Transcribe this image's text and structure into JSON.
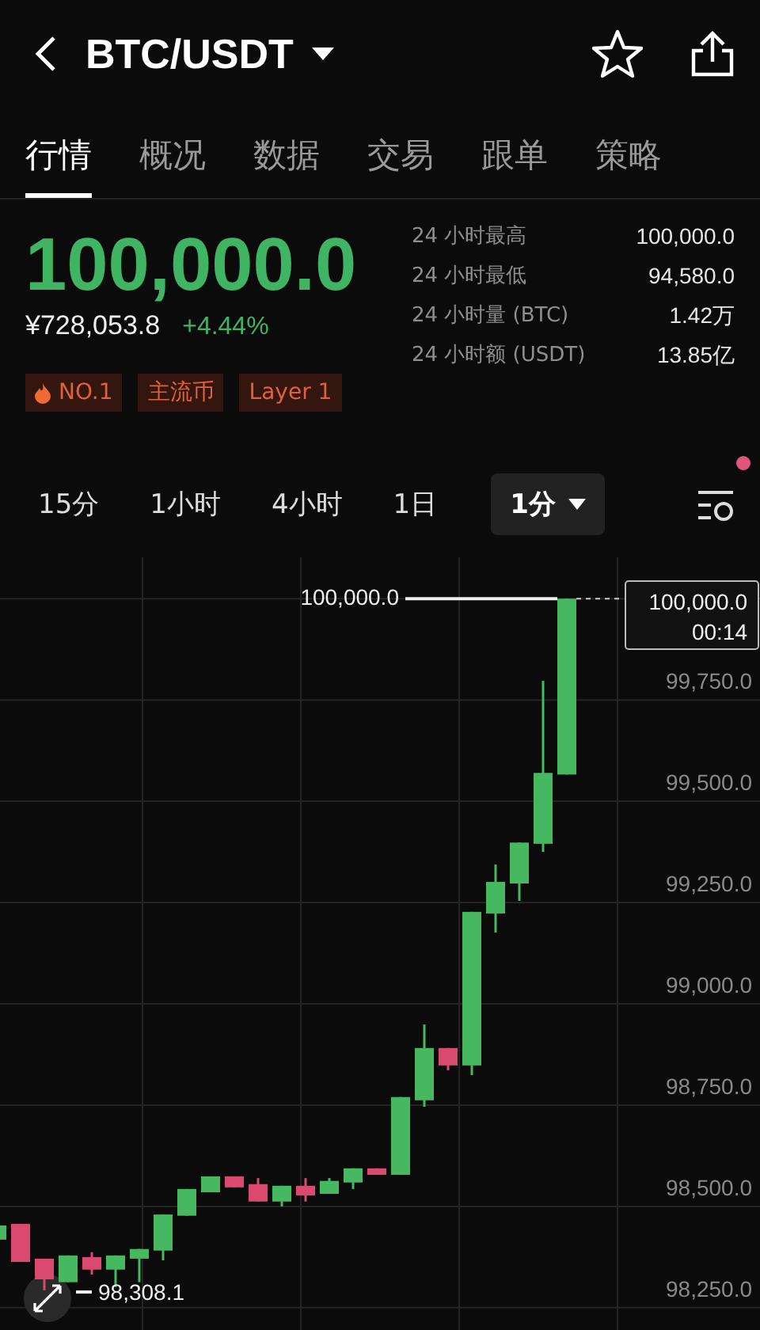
{
  "header": {
    "title": "BTC/USDT",
    "favorite": false
  },
  "tabs": [
    {
      "label": "行情",
      "selected": true
    },
    {
      "label": "概况",
      "selected": false
    },
    {
      "label": "数据",
      "selected": false
    },
    {
      "label": "交易",
      "selected": false
    },
    {
      "label": "跟单",
      "selected": false
    },
    {
      "label": "策略",
      "selected": false
    }
  ],
  "price": {
    "last": "100,000.0",
    "cny": "¥728,053.8",
    "change": "+4.44%"
  },
  "stats": [
    {
      "label": "24 小时最高",
      "value": "100,000.0"
    },
    {
      "label": "24 小时最低",
      "value": "94,580.0"
    },
    {
      "label": "24 小时量 (BTC)",
      "value": "1.42万"
    },
    {
      "label": "24 小时额 (USDT)",
      "value": "13.85亿"
    }
  ],
  "tags": [
    {
      "kind": "hot",
      "label": "NO.1"
    },
    {
      "kind": "plain",
      "label": "主流币"
    },
    {
      "kind": "plain",
      "label": "Layer 1"
    }
  ],
  "intervals": [
    {
      "label": "15分",
      "selected": false
    },
    {
      "label": "1小时",
      "selected": false
    },
    {
      "label": "4小时",
      "selected": false
    },
    {
      "label": "1日",
      "selected": false
    },
    {
      "label": "1分",
      "selected": true
    }
  ],
  "settings": {
    "notification": true
  },
  "chart": {
    "chart_data": {
      "type": "candlestick",
      "grid": true,
      "ohlc": [
        [
          98418,
          98453,
          98418,
          98453
        ],
        [
          98457,
          98457,
          98363,
          98363
        ],
        [
          98371,
          98371,
          98293,
          98320
        ],
        [
          98313,
          98379,
          98313,
          98379
        ],
        [
          98375,
          98387,
          98332,
          98344
        ],
        [
          98344,
          98379,
          98301,
          98379
        ],
        [
          98371,
          98395,
          98313,
          98395
        ],
        [
          98391,
          98480,
          98367,
          98480
        ],
        [
          98477,
          98543,
          98477,
          98543
        ],
        [
          98535,
          98574,
          98535,
          98574
        ],
        [
          98574,
          98574,
          98547,
          98547
        ],
        [
          98555,
          98570,
          98512,
          98512
        ],
        [
          98512,
          98551,
          98500,
          98551
        ],
        [
          98551,
          98570,
          98512,
          98527
        ],
        [
          98531,
          98570,
          98531,
          98563
        ],
        [
          98559,
          98594,
          98543,
          98594
        ],
        [
          98594,
          98594,
          98578,
          98578
        ],
        [
          98578,
          98770,
          98578,
          98770
        ],
        [
          98762,
          98949,
          98746,
          98891
        ],
        [
          98891,
          98891,
          98836,
          98848
        ],
        [
          98848,
          99227,
          98824,
          99227
        ],
        [
          99223,
          99344,
          99176,
          99301
        ],
        [
          99297,
          99398,
          99254,
          99398
        ],
        [
          99395,
          99797,
          99375,
          99570
        ],
        [
          99566,
          100000,
          99566,
          100000
        ]
      ],
      "ylim": [
        98195,
        100102
      ],
      "yticks": [
        {
          "value": 99750,
          "label": "99,750.0"
        },
        {
          "value": 99500,
          "label": "99,500.0"
        },
        {
          "value": 99250,
          "label": "99,250.0"
        },
        {
          "value": 99000,
          "label": "99,000.0"
        },
        {
          "value": 98750,
          "label": "98,750.0"
        },
        {
          "value": 98500,
          "label": "98,500.0"
        },
        {
          "value": 98250,
          "label": "98,250.0"
        }
      ]
    },
    "high_label": "100,000.0",
    "low_label": "98,308.1",
    "tooltip": {
      "price": "100,000.0",
      "time": "00:14"
    }
  }
}
